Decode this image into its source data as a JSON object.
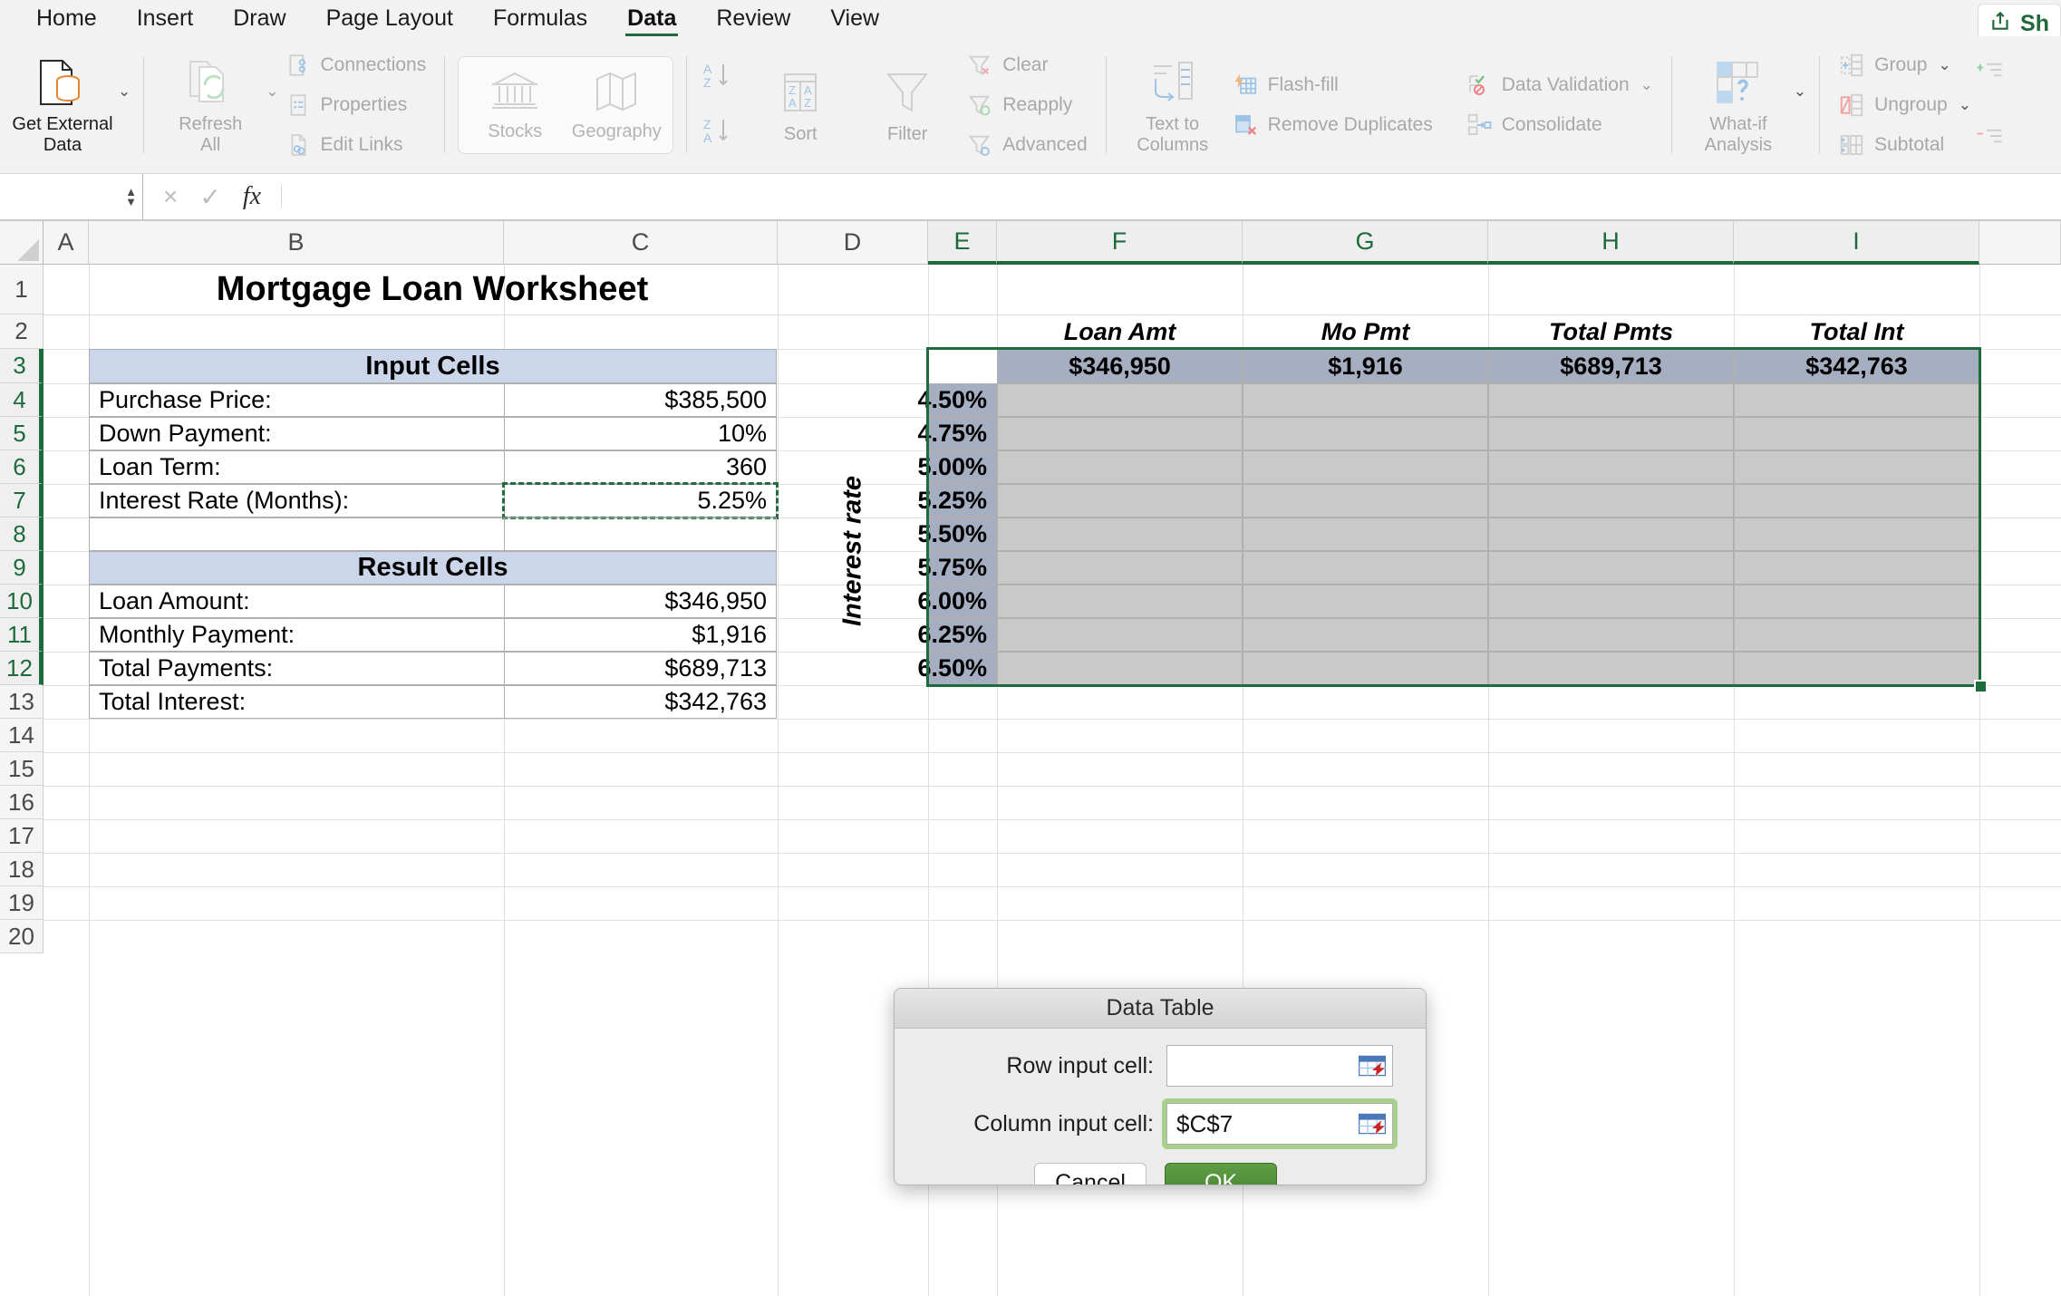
{
  "ribbon": {
    "tabs": [
      {
        "label": "Home",
        "active": false
      },
      {
        "label": "Insert",
        "active": false
      },
      {
        "label": "Draw",
        "active": false
      },
      {
        "label": "Page Layout",
        "active": false
      },
      {
        "label": "Formulas",
        "active": false
      },
      {
        "label": "Data",
        "active": true
      },
      {
        "label": "Review",
        "active": false
      },
      {
        "label": "View",
        "active": false
      }
    ],
    "share_label": "Sh",
    "get_external_data": "Get External\nData",
    "get_external_data_l1": "Get External",
    "get_external_data_l2": "Data",
    "refresh_all_l1": "Refresh",
    "refresh_all_l2": "All",
    "connections": "Connections",
    "properties": "Properties",
    "edit_links": "Edit Links",
    "stocks": "Stocks",
    "geography": "Geography",
    "sort": "Sort",
    "filter": "Filter",
    "clear": "Clear",
    "reapply": "Reapply",
    "advanced": "Advanced",
    "text_to_columns_l1": "Text to",
    "text_to_columns_l2": "Columns",
    "flash_fill": "Flash-fill",
    "remove_duplicates": "Remove Duplicates",
    "data_validation": "Data Validation",
    "consolidate": "Consolidate",
    "what_if_l1": "What-if",
    "what_if_l2": "Analysis",
    "group": "Group",
    "ungroup": "Ungroup",
    "subtotal": "Subtotal"
  },
  "formula_bar": {
    "name_box_value": "",
    "formula_value": "",
    "cancel_icon": "×",
    "confirm_icon": "✓",
    "fx_label": "fx"
  },
  "grid": {
    "columns": [
      "A",
      "B",
      "C",
      "D",
      "E",
      "F",
      "G",
      "H",
      "I"
    ],
    "selected_columns": [
      "E",
      "F",
      "G",
      "H",
      "I"
    ],
    "rows": [
      "1",
      "2",
      "3",
      "4",
      "5",
      "6",
      "7",
      "8",
      "9",
      "10",
      "11",
      "12",
      "13",
      "14",
      "15",
      "16",
      "17",
      "18",
      "19",
      "20"
    ],
    "selected_rows": [
      "3",
      "4",
      "5",
      "6",
      "7",
      "8",
      "9",
      "10",
      "11",
      "12"
    ]
  },
  "worksheet": {
    "title": "Mortgage Loan Worksheet",
    "input_header": "Input Cells",
    "input_rows": [
      {
        "label": "Purchase Price:",
        "value": "$385,500"
      },
      {
        "label": "Down Payment:",
        "value": "10%"
      },
      {
        "label": "Loan Term:",
        "value": "360"
      },
      {
        "label": "Interest Rate (Months):",
        "value": "5.25%"
      }
    ],
    "result_header": "Result Cells",
    "result_rows": [
      {
        "label": "Loan Amount:",
        "value": "$346,950"
      },
      {
        "label": "Monthly Payment:",
        "value": "$1,916"
      },
      {
        "label": "Total Payments:",
        "value": "$689,713"
      },
      {
        "label": "Total Interest:",
        "value": "$342,763"
      }
    ]
  },
  "data_table": {
    "axis_label": "Interest rate",
    "column_headers": [
      "Loan Amt",
      "Mo Pmt",
      "Total Pmts",
      "Total Int"
    ],
    "formula_row": [
      "$346,950",
      "$1,916",
      "$689,713",
      "$342,763"
    ],
    "rate_values": [
      "4.50%",
      "4.75%",
      "5.00%",
      "5.25%",
      "5.50%",
      "5.75%",
      "6.00%",
      "6.25%",
      "6.50%"
    ],
    "body_values": [
      [
        "",
        "",
        "",
        ""
      ],
      [
        "",
        "",
        "",
        ""
      ],
      [
        "",
        "",
        "",
        ""
      ],
      [
        "",
        "",
        "",
        ""
      ],
      [
        "",
        "",
        "",
        ""
      ],
      [
        "",
        "",
        "",
        ""
      ],
      [
        "",
        "",
        "",
        ""
      ],
      [
        "",
        "",
        "",
        ""
      ],
      [
        "",
        "",
        "",
        ""
      ]
    ]
  },
  "dialog": {
    "title": "Data Table",
    "row_input_label": "Row input cell:",
    "row_input_value": "",
    "column_input_label": "Column input cell:",
    "column_input_value": "$C$7",
    "cancel_label": "Cancel",
    "ok_label": "OK"
  },
  "colors": {
    "accent_green": "#1d6b3c",
    "band_blue": "#ccd6ea",
    "table_header_fill": "#a6afc1",
    "table_body_fill": "#c9c9c9"
  }
}
